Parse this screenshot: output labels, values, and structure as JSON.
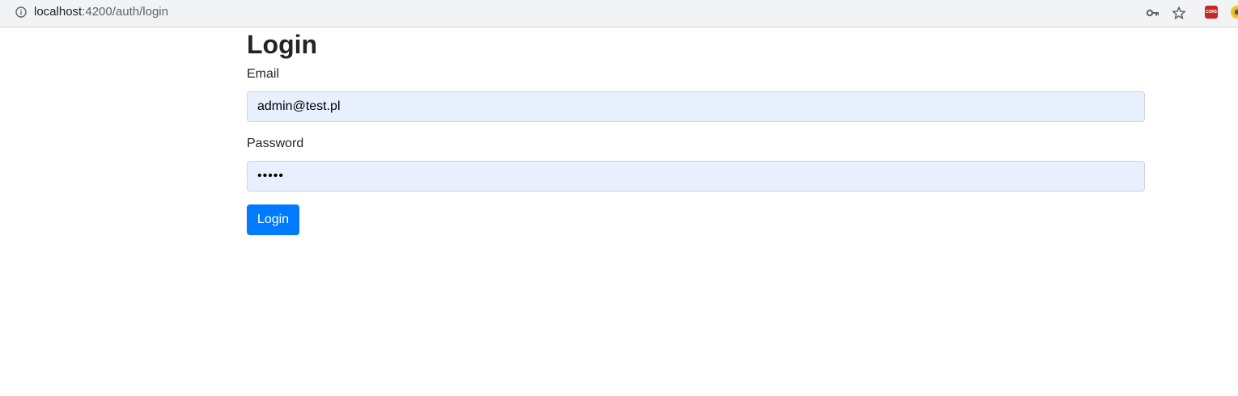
{
  "browser": {
    "url_host": "localhost",
    "url_path": ":4200/auth/login",
    "icons": [
      "info-icon",
      "key-icon",
      "star-icon",
      "cors-extension-icon",
      "extension-icon"
    ],
    "cors_label": "CORS"
  },
  "page": {
    "title": "Login",
    "email_label": "Email",
    "email_value": "admin@test.pl",
    "password_label": "Password",
    "password_value": "•••••",
    "submit_label": "Login"
  },
  "colors": {
    "primary": "#007bff",
    "input_autofill_bg": "#e8f0fe",
    "text": "#212529"
  }
}
